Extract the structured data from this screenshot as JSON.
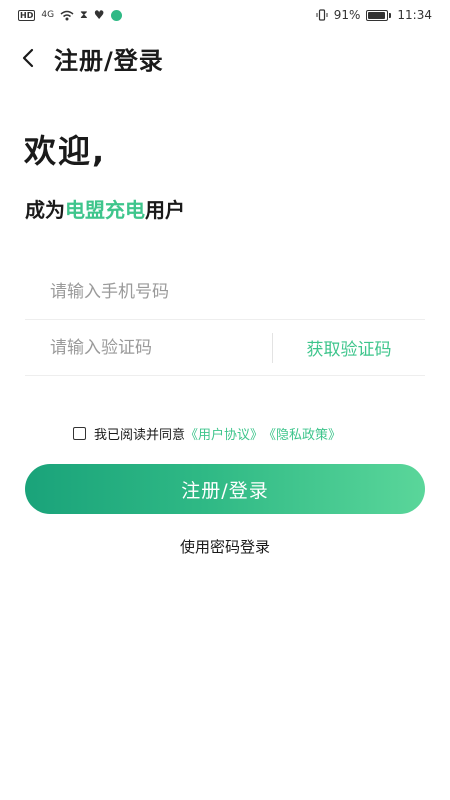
{
  "status_bar": {
    "hd": "HD",
    "signal": "4G",
    "battery_percent": "91%",
    "time": "11:34",
    "battery_level": 0.91
  },
  "nav": {
    "title": "注册/登录"
  },
  "welcome": {
    "heading": "欢迎,",
    "sub_prefix": "成为",
    "brand": "电盟充电",
    "sub_suffix": "用户"
  },
  "form": {
    "phone_placeholder": "请输入手机号码",
    "code_placeholder": "请输入验证码",
    "get_code_label": "获取验证码"
  },
  "agreement": {
    "text": "我已阅读并同意",
    "user_agreement": "《用户协议》",
    "privacy_policy": "《隐私政策》"
  },
  "buttons": {
    "submit_label": "注册/登录",
    "password_login_label": "使用密码登录"
  },
  "colors": {
    "accent": "#3ec58c",
    "button_start": "#1aa37a",
    "button_end": "#5ad69a"
  }
}
